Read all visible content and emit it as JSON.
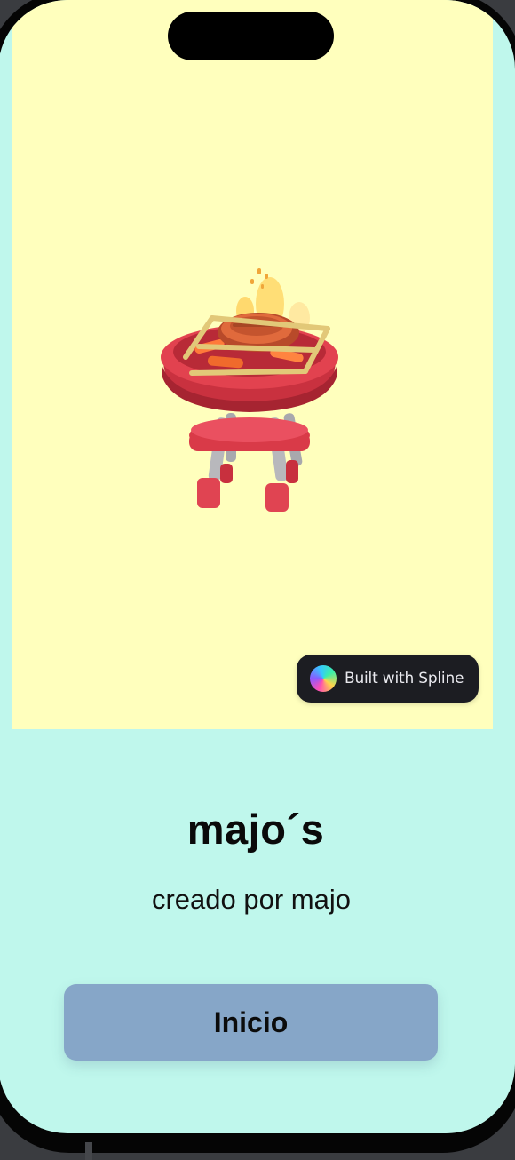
{
  "spline": {
    "badge_label": "Built with Spline",
    "background_color": "#ffffbd"
  },
  "app": {
    "title": "majo´s",
    "subtitle": "creado por majo",
    "background_color": "#bff7ec"
  },
  "actions": {
    "start_label": "Inicio",
    "start_color": "#86a6c8"
  },
  "icons": {
    "spline_logo": "spline-logo-icon",
    "model": "grill-icon"
  }
}
